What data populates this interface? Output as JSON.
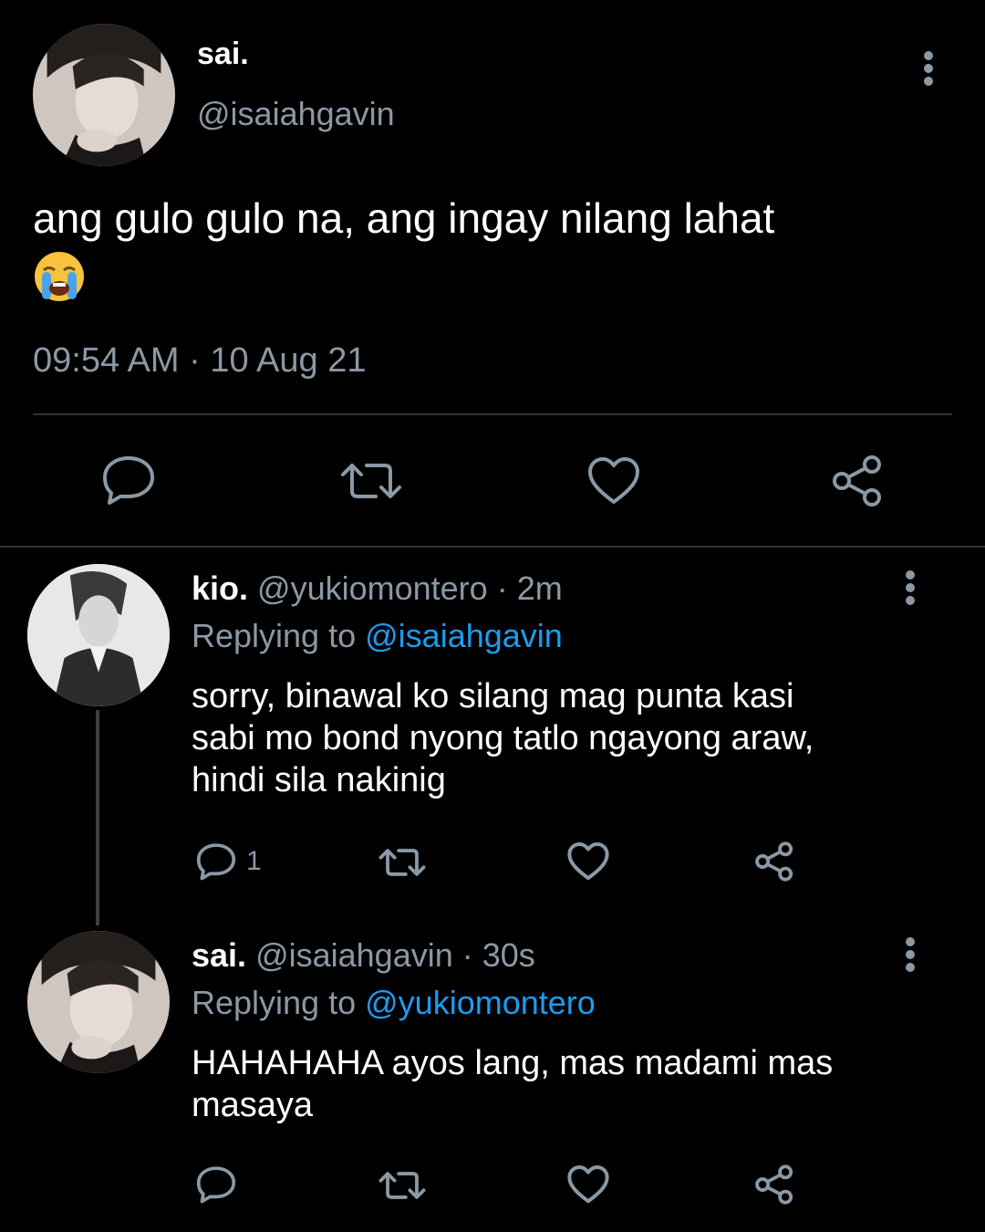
{
  "main_tweet": {
    "author_name": "sai.",
    "author_handle": "@isaiahgavin",
    "text": "ang gulo gulo na, ang ingay nilang lahat",
    "emoji": "loudly-crying-face",
    "time": "09:54 AM · 10 Aug 21",
    "actions": {
      "reply_icon": "reply-icon",
      "retweet_icon": "retweet-icon",
      "like_icon": "heart-icon",
      "share_icon": "share-icon"
    }
  },
  "replies": [
    {
      "author_name": "kio.",
      "author_handle": "@yukiomontero",
      "time": "· 2m",
      "replying_prefix": "Replying to",
      "replying_to": "@isaiahgavin",
      "text_lines": [
        "sorry, binawal ko silang mag punta kasi",
        "sabi mo bond nyong tatlo ngayong araw,",
        "hindi sila nakinig"
      ],
      "reply_count": "1"
    },
    {
      "author_name": "sai.",
      "author_handle": "@isaiahgavin",
      "time": "· 30s",
      "replying_prefix": "Replying to",
      "replying_to": "@yukiomontero",
      "text_lines": [
        "HAHAHAHA ayos lang, mas madami mas",
        "masaya"
      ],
      "reply_count": ""
    }
  ],
  "colors": {
    "background": "#000000",
    "text": "#ffffff",
    "secondary": "#8b98a5",
    "accent": "#1d9bf0",
    "divider": "#2f3336"
  }
}
